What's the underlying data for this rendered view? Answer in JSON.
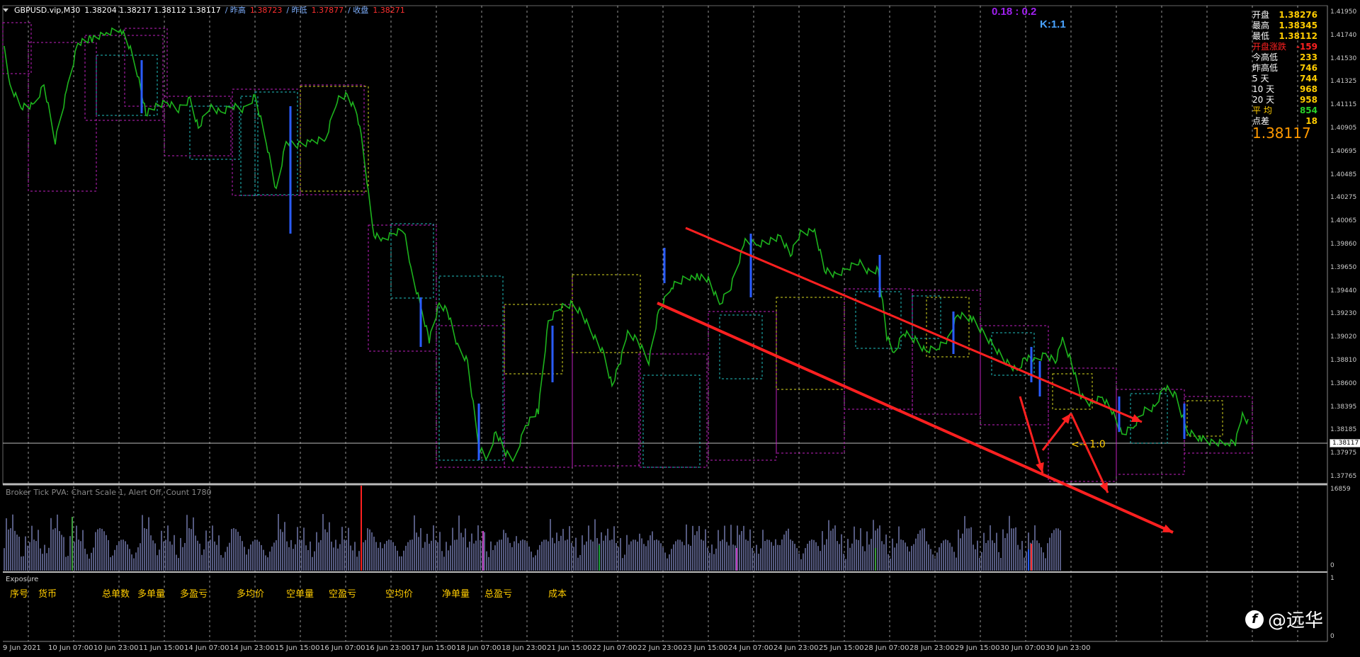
{
  "header": {
    "symbol": "GBPUSD.vip,M30",
    "ohlc": "1.38204 1.38217 1.38112 1.38117",
    "prev_high_label": "/ 昨高",
    "prev_high": "1.38723",
    "prev_low_label": "/ 昨低",
    "prev_low": "1.37877",
    "close_label": "/ 收盘",
    "close": "1.38271"
  },
  "kinfo": {
    "ratio": "0.18 : 0.2",
    "k": "K:1.1"
  },
  "stats": {
    "rows": [
      {
        "label": "开盘",
        "value": "1.38276",
        "style": ""
      },
      {
        "label": "最高",
        "value": "1.38345",
        "style": ""
      },
      {
        "label": "最低",
        "value": "1.38112",
        "style": ""
      },
      {
        "label": "开盘涨跌",
        "value": "-159",
        "style": "red"
      },
      {
        "label": "今高低",
        "value": "233",
        "style": ""
      },
      {
        "label": "昨高低",
        "value": "746",
        "style": ""
      },
      {
        "label": "5  天",
        "value": "744",
        "style": ""
      },
      {
        "label": "10 天",
        "value": "968",
        "style": ""
      },
      {
        "label": "20 天",
        "value": "958",
        "style": ""
      },
      {
        "label": "平 均",
        "value": "854",
        "style": "grn yel"
      },
      {
        "label": "点差",
        "value": "18",
        "style": ""
      }
    ],
    "price": "1.38117"
  },
  "price_axis": [
    "1.41950",
    "1.41740",
    "1.41530",
    "1.41325",
    "1.41115",
    "1.40905",
    "1.40695",
    "1.40485",
    "1.40275",
    "1.40065",
    "1.39860",
    "1.39650",
    "1.39440",
    "1.39230",
    "1.39020",
    "1.38810",
    "1.38600",
    "1.38395",
    "1.38185",
    "1.37975",
    "1.37765"
  ],
  "current_price": "1.38117",
  "volume_axis": {
    "top": "16859",
    "bottom": "0"
  },
  "exposure_axis": {
    "top": "1",
    "bottom": "0"
  },
  "time_axis": [
    "9 Jun 2021",
    "10 Jun 07:00",
    "10 Jun 23:00",
    "11 Jun 15:00",
    "14 Jun 07:00",
    "14 Jun 23:00",
    "15 Jun 15:00",
    "16 Jun 07:00",
    "16 Jun 23:00",
    "17 Jun 15:00",
    "18 Jun 07:00",
    "18 Jun 23:00",
    "21 Jun 15:00",
    "22 Jun 07:00",
    "22 Jun 23:00",
    "23 Jun 15:00",
    "24 Jun 07:00",
    "24 Jun 23:00",
    "25 Jun 15:00",
    "28 Jun 07:00",
    "28 Jun 23:00",
    "29 Jun 15:00",
    "30 Jun 07:00",
    "30 Jun 23:00"
  ],
  "indicator_title": "Broker Tick PVA:   Chart Scale  1,  Alert Off,  Count   1780",
  "exposure": {
    "title": "Exposure",
    "columns": [
      "序号",
      "货币",
      "总单数",
      "多单量",
      "多盈亏",
      "多均价",
      "空单量",
      "空盈亏",
      "空均价",
      "净单量",
      "总盈亏",
      "成本"
    ]
  },
  "annotation": "<-- 1:0",
  "watermark": "@远华",
  "colors": {
    "candle": "#1db31d",
    "down_wick": "#2a5cff",
    "box_magenta": "#c020c0",
    "box_cyan": "#20c0c0",
    "box_yellow": "#d8d820",
    "channel": "#ff2020",
    "grid": "#c8c8c8"
  }
}
